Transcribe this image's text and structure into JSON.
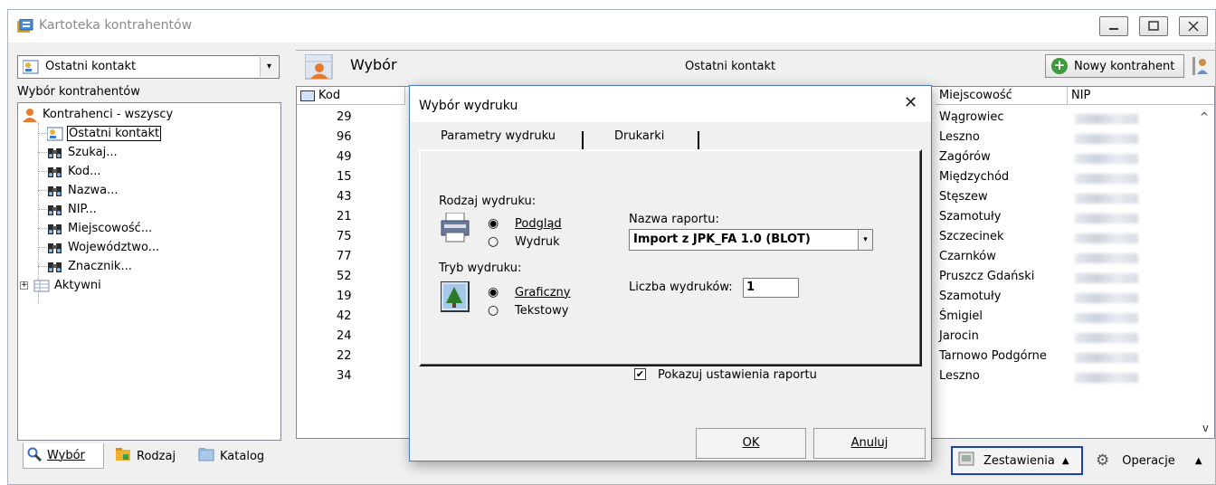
{
  "window": {
    "title": "Kartoteka kontrahentów"
  },
  "left": {
    "combo_value": "Ostatni kontakt",
    "header": "Wybór kontrahentów",
    "tree": [
      {
        "label": "Kontrahenci - wszyscy",
        "icon": "people-icon"
      },
      {
        "label": "Ostatni kontakt",
        "icon": "contact-card-icon",
        "selected": true
      },
      {
        "label": "Szukaj...",
        "icon": "binoculars-icon"
      },
      {
        "label": "Kod...",
        "icon": "binoculars-icon"
      },
      {
        "label": "Nazwa...",
        "icon": "binoculars-icon"
      },
      {
        "label": "NIP...",
        "icon": "binoculars-icon"
      },
      {
        "label": "Miejscowość...",
        "icon": "binoculars-icon"
      },
      {
        "label": "Województwo...",
        "icon": "binoculars-icon"
      },
      {
        "label": "Znacznik...",
        "icon": "binoculars-icon"
      },
      {
        "label": "Aktywni",
        "icon": "table-icon",
        "expand": "+"
      }
    ],
    "tabs": [
      {
        "label": "Wybór",
        "underline": "W"
      },
      {
        "label": "Rodzaj",
        "underline": "R"
      },
      {
        "label": "Katalog",
        "underline": "K"
      }
    ]
  },
  "right": {
    "title": "Wybór",
    "subtitle": "Ostatni kontakt",
    "new_button": "Nowy kontrahent",
    "columns": {
      "kod": "Kod",
      "city": "Miejscowość",
      "nip": "NIP"
    },
    "rows": [
      {
        "kod": "29",
        "city": "Wągrowiec"
      },
      {
        "kod": "96",
        "city": "Leszno"
      },
      {
        "kod": "49",
        "city": "Zagórów"
      },
      {
        "kod": "15",
        "city": "Międzychód"
      },
      {
        "kod": "43",
        "city": "Stęszew"
      },
      {
        "kod": "21",
        "city": "Szamotuły"
      },
      {
        "kod": "75",
        "city": "Szczecinek"
      },
      {
        "kod": "77",
        "city": "Czarnków"
      },
      {
        "kod": "52",
        "city": "Pruszcz Gdański"
      },
      {
        "kod": "19",
        "city": "Szamotuły"
      },
      {
        "kod": "42",
        "city": "Śmigiel"
      },
      {
        "kod": "24",
        "city": "Jarocin"
      },
      {
        "kod": "22",
        "city": "Tarnowo Podgórne"
      },
      {
        "kod": "34",
        "city": "Leszno"
      }
    ],
    "bottom": {
      "zestawienia": "Zestawienia",
      "operacje": "Operacje"
    }
  },
  "dialog": {
    "title": "Wybór wydruku",
    "tabs": [
      "Parametry wydruku",
      "Drukarki"
    ],
    "rodzaj_label": "Rodzaj wydruku:",
    "rodzaj_options": [
      "Podgląd",
      "Wydruk"
    ],
    "tryb_label": "Tryb wydruku:",
    "tryb_options": [
      "Graficzny",
      "Tekstowy"
    ],
    "nazwa_label": "Nazwa raportu:",
    "nazwa_value": "Import z JPK_FA 1.0 (BLOT)",
    "liczba_label": "Liczba wydruków:",
    "liczba_value": "1",
    "checkbox_label": "Pokazuj ustawienia raportu",
    "ok": "OK",
    "cancel": "Anuluj"
  }
}
